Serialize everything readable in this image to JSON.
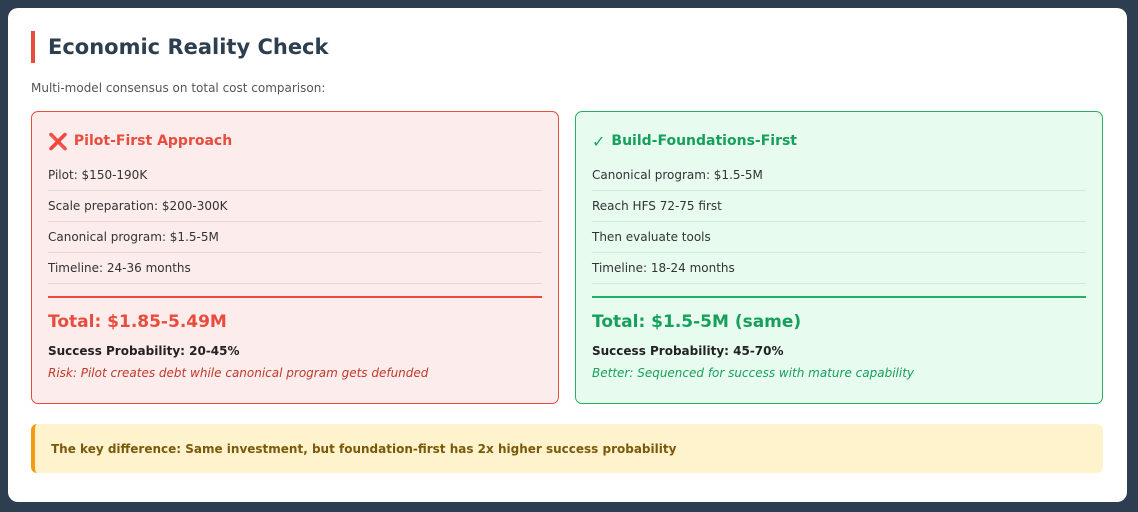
{
  "header": {
    "title": "Economic Reality Check",
    "subtitle": "Multi-model consensus on total cost comparison:"
  },
  "cards": {
    "pilot": {
      "icon": "❌",
      "icon_name": "cross-mark-icon",
      "title": "Pilot-First Approach",
      "items": [
        "Pilot: $150-190K",
        "Scale preparation: $200-300K",
        "Canonical program: $1.5-5M",
        "Timeline: 24-36 months"
      ],
      "total": "Total: $1.85-5.49M",
      "probability": "Success Probability: 20-45%",
      "note": "Risk: Pilot creates debt while canonical program gets defunded",
      "accent": "#e74c3c"
    },
    "foundation": {
      "icon": "✓",
      "icon_name": "check-mark-icon",
      "title": "Build-Foundations-First",
      "items": [
        "Canonical program: $1.5-5M",
        "Reach HFS 72-75 first",
        "Then evaluate tools",
        "Timeline: 18-24 months"
      ],
      "total": "Total: $1.5-5M (same)",
      "probability": "Success Probability: 45-70%",
      "note": "Better: Sequenced for success with mature capability",
      "accent": "#27ae60"
    }
  },
  "callout": {
    "text": "The key difference: Same investment, but foundation-first has 2x higher success probability",
    "accent": "#f39c12"
  }
}
